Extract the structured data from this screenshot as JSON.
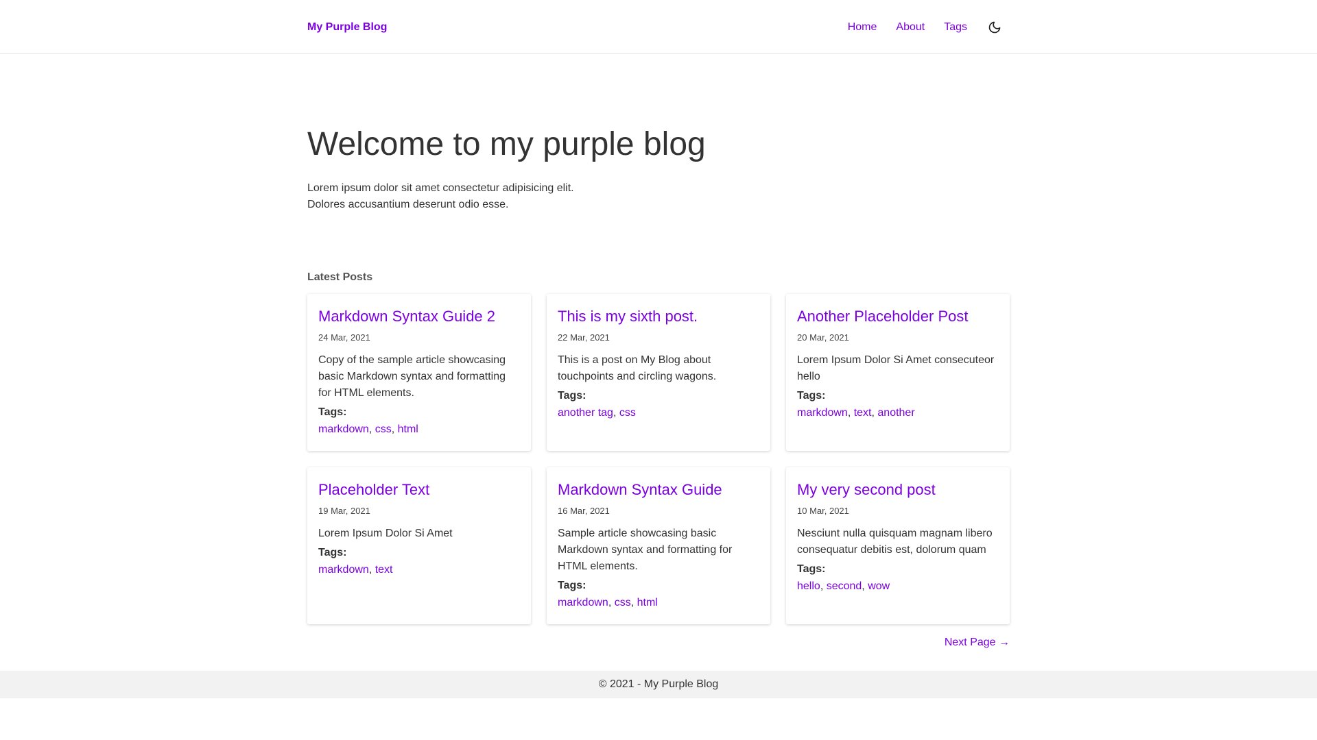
{
  "header": {
    "brand": "My Purple Blog",
    "nav": [
      {
        "label": "Home"
      },
      {
        "label": "About"
      },
      {
        "label": "Tags"
      }
    ],
    "theme_icon": "moon-icon"
  },
  "hero": {
    "title": "Welcome to my purple blog",
    "intro_line1": "Lorem ipsum dolor sit amet consectetur adipisicing elit.",
    "intro_line2": "Dolores accusantium deserunt odio esse."
  },
  "latest": {
    "heading": "Latest Posts",
    "tags_label": "Tags:",
    "posts": [
      {
        "title": "Markdown Syntax Guide 2",
        "date": "24 Mar, 2021",
        "desc": "Copy of the sample article showcasing basic Markdown syntax and formatting for HTML elements.",
        "tags": [
          "markdown",
          "css",
          "html"
        ]
      },
      {
        "title": "This is my sixth post.",
        "date": "22 Mar, 2021",
        "desc": "This is a post on My Blog about touchpoints and circling wagons.",
        "tags": [
          "another tag",
          "css"
        ]
      },
      {
        "title": "Another Placeholder Post",
        "date": "20 Mar, 2021",
        "desc": "Lorem Ipsum Dolor Si Amet consecuteor hello",
        "tags": [
          "markdown",
          "text",
          "another"
        ]
      },
      {
        "title": "Placeholder Text",
        "date": "19 Mar, 2021",
        "desc": "Lorem Ipsum Dolor Si Amet",
        "tags": [
          "markdown",
          "text"
        ]
      },
      {
        "title": "Markdown Syntax Guide",
        "date": "16 Mar, 2021",
        "desc": "Sample article showcasing basic Markdown syntax and formatting for HTML elements.",
        "tags": [
          "markdown",
          "css",
          "html"
        ]
      },
      {
        "title": "My very second post",
        "date": "10 Mar, 2021",
        "desc": "Nesciunt nulla quisquam magnam libero consequatur debitis est, dolorum quam",
        "tags": [
          "hello",
          "second",
          "wow"
        ]
      }
    ]
  },
  "pager": {
    "next_label": "Next Page →"
  },
  "footer": {
    "text": "© 2021 - My Purple Blog"
  },
  "colors": {
    "accent": "#7b00e0",
    "text": "#333333",
    "footer_bg": "#f2f2f2"
  }
}
